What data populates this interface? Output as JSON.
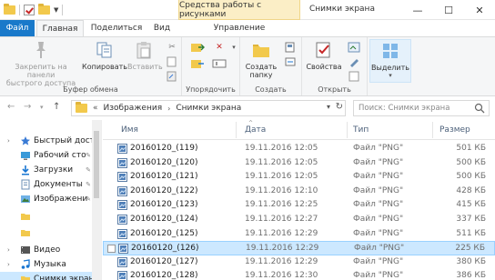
{
  "titlebar": {
    "tools_tab": "Средства работы с рисунками",
    "title": "Снимки экрана",
    "minimize": "—",
    "maximize": "☐",
    "close": "✕"
  },
  "tabs": {
    "file": "Файл",
    "home": "Главная",
    "share": "Поделиться",
    "view": "Вид",
    "manage": "Управление"
  },
  "ribbon": {
    "pin_label": "Закрепить на панели быстрого доступа",
    "pin_line1": "Закрепить на панели",
    "pin_line2": "быстрого доступа",
    "copy": "Копировать",
    "paste": "Вставить",
    "clipboard_group": "Буфер обмена",
    "organize_group": "Упорядочить",
    "new_folder_line1": "Создать",
    "new_folder_line2": "папку",
    "create_group": "Создать",
    "properties": "Свойства",
    "open_group": "Открыть",
    "select": "Выделить"
  },
  "address": {
    "path": [
      "Изображения",
      "Снимки экрана"
    ],
    "search_placeholder": "Поиск: Снимки экрана"
  },
  "nav_pane": {
    "items": [
      {
        "label": "Быстрый доступ",
        "icon": "star-icon"
      },
      {
        "label": "Рабочий сто",
        "icon": "desktop-icon"
      },
      {
        "label": "Загрузки",
        "icon": "download-icon"
      },
      {
        "label": "Документы",
        "icon": "documents-icon"
      },
      {
        "label": "Изображени",
        "icon": "pictures-icon"
      },
      {
        "label": "",
        "icon": "folder-icon"
      },
      {
        "label": "",
        "icon": "folder-icon"
      },
      {
        "label": "Видео",
        "icon": "video-icon"
      },
      {
        "label": "Музыка",
        "icon": "music-icon"
      },
      {
        "label": "Снимки экрана",
        "icon": "folder-icon"
      }
    ]
  },
  "columns": {
    "name": "Имя",
    "date": "Дата",
    "type": "Тип",
    "size": "Размер"
  },
  "files": [
    {
      "name": "20160120_(119)",
      "date": "19.11.2016 12:05",
      "type": "Файл \"PNG\"",
      "size": "501 КБ"
    },
    {
      "name": "20160120_(120)",
      "date": "19.11.2016 12:05",
      "type": "Файл \"PNG\"",
      "size": "500 КБ"
    },
    {
      "name": "20160120_(121)",
      "date": "19.11.2016 12:05",
      "type": "Файл \"PNG\"",
      "size": "500 КБ"
    },
    {
      "name": "20160120_(122)",
      "date": "19.11.2016 12:10",
      "type": "Файл \"PNG\"",
      "size": "428 КБ"
    },
    {
      "name": "20160120_(123)",
      "date": "19.11.2016 12:25",
      "type": "Файл \"PNG\"",
      "size": "415 КБ"
    },
    {
      "name": "20160120_(124)",
      "date": "19.11.2016 12:27",
      "type": "Файл \"PNG\"",
      "size": "337 КБ"
    },
    {
      "name": "20160120_(125)",
      "date": "19.11.2016 12:29",
      "type": "Файл \"PNG\"",
      "size": "511 КБ"
    },
    {
      "name": "20160120_(126)",
      "date": "19.11.2016 12:29",
      "type": "Файл \"PNG\"",
      "size": "225 КБ"
    },
    {
      "name": "20160120_(127)",
      "date": "19.11.2016 12:29",
      "type": "Файл \"PNG\"",
      "size": "380 КБ"
    },
    {
      "name": "20160120_(128)",
      "date": "19.11.2016 12:30",
      "type": "Файл \"PNG\"",
      "size": "386 КБ"
    }
  ],
  "selected_file_index": 7,
  "colors": {
    "file_tab": "#1979ca",
    "tools_tab": "#fbeec6",
    "selection": "#cce8ff"
  }
}
